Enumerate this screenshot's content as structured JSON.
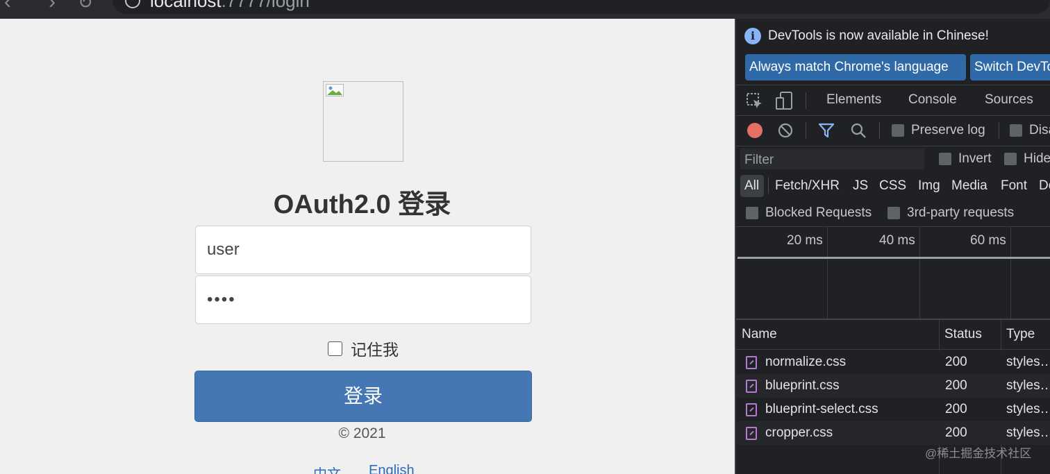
{
  "browser": {
    "url_host": "localhost",
    "url_rest": ":7777/login"
  },
  "login": {
    "title": "OAuth2.0 登录",
    "username_value": "user",
    "password_value": "••••",
    "remember_label": "记住我",
    "submit_label": "登录",
    "copyright": "© 2021",
    "lang_zh": "中文",
    "lang_en": "English"
  },
  "devtools": {
    "info_message": "DevTools is now available in Chinese!",
    "match_button": "Always match Chrome's language",
    "switch_button": "Switch DevTools to Chinese",
    "tabs": [
      "Elements",
      "Console",
      "Sources"
    ],
    "preserve_log": "Preserve log",
    "disable_cache": "Disable cache",
    "filter_placeholder": "Filter",
    "invert": "Invert",
    "hide_data_urls": "Hide data URLs",
    "types": [
      "All",
      "Fetch/XHR",
      "JS",
      "CSS",
      "Img",
      "Media",
      "Font",
      "Doc"
    ],
    "blocked_requests": "Blocked Requests",
    "third_party": "3rd-party requests",
    "ticks": [
      "20 ms",
      "40 ms",
      "60 ms"
    ],
    "columns": {
      "name": "Name",
      "status": "Status",
      "type": "Type"
    },
    "requests": [
      {
        "name": "normalize.css",
        "status": "200",
        "type": "styles…"
      },
      {
        "name": "blueprint.css",
        "status": "200",
        "type": "styles…"
      },
      {
        "name": "blueprint-select.css",
        "status": "200",
        "type": "styles…"
      },
      {
        "name": "cropper.css",
        "status": "200",
        "type": "styles…"
      }
    ]
  },
  "watermark": "@稀土掘金技术社区",
  "colors": {
    "login_button": "#4477b3",
    "devtools_bg": "#202124",
    "lang_link": "#2d6ab4",
    "record": "#e46f62",
    "file_icon": "#b47bd1"
  }
}
